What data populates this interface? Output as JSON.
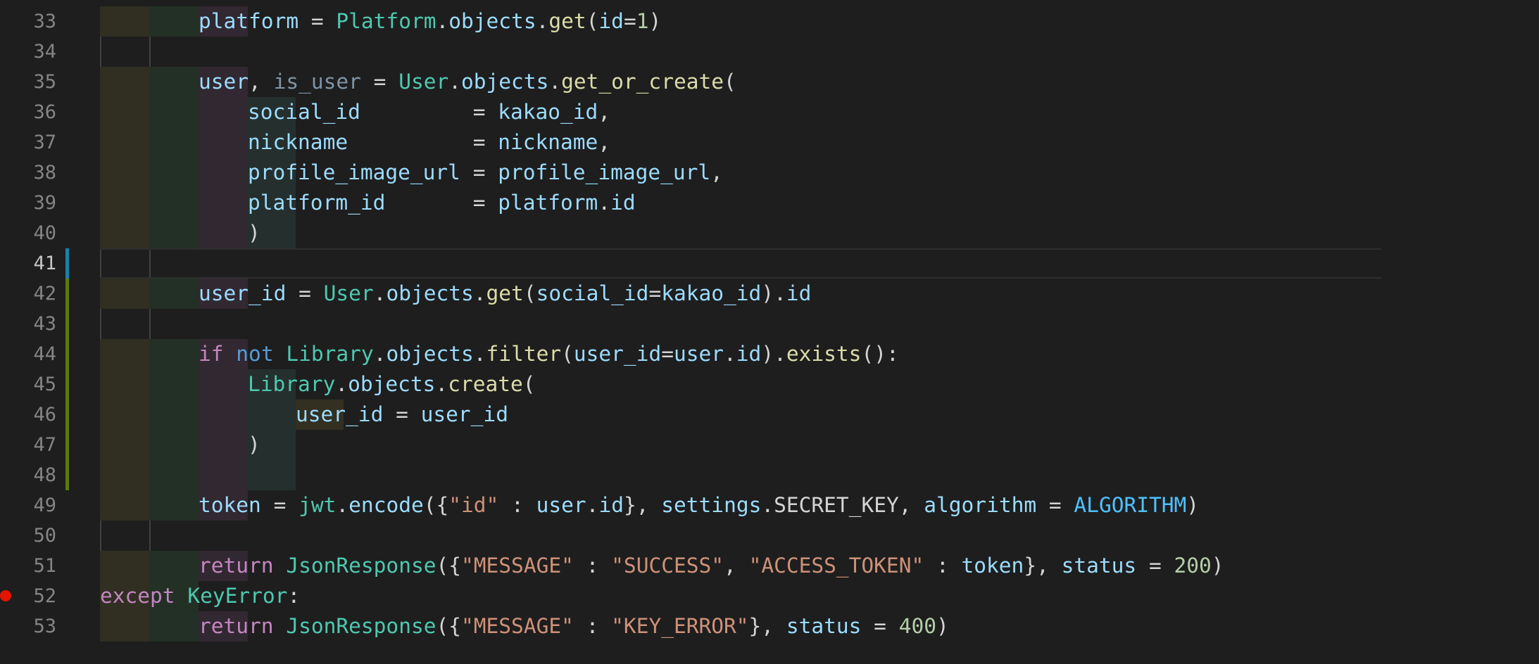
{
  "colors": {
    "background": "#1e1e1e",
    "line_number": "#858585",
    "keyword": "#c586c0",
    "keyword_alt": "#569cd6",
    "class": "#4ec9b0",
    "function": "#dcdcaa",
    "variable": "#9cdcfe",
    "string": "#ce9178",
    "number": "#b5cea8",
    "constant": "#4fc1ff",
    "breakpoint": "#e51400",
    "modified_marker": "#1b81a8",
    "added_marker": "#587c0c"
  },
  "editor": {
    "lines": [
      {
        "num": "33",
        "indent": 2,
        "bands": 3,
        "tokens": [
          [
            "t-var",
            "platform"
          ],
          [
            "t-op",
            " = "
          ],
          [
            "t-cls",
            "Platform"
          ],
          [
            "t-op",
            "."
          ],
          [
            "t-var",
            "objects"
          ],
          [
            "t-op",
            "."
          ],
          [
            "t-fn",
            "get"
          ],
          [
            "t-op",
            "("
          ],
          [
            "t-var",
            "id"
          ],
          [
            "t-op",
            "="
          ],
          [
            "t-num",
            "1"
          ],
          [
            "t-op",
            ")"
          ]
        ]
      },
      {
        "num": "34",
        "indent": 2,
        "bands": 0,
        "tokens": []
      },
      {
        "num": "35",
        "indent": 2,
        "bands": 3,
        "tokens": [
          [
            "t-var",
            "user"
          ],
          [
            "t-op",
            ", "
          ],
          [
            "t-dim",
            "is_user"
          ],
          [
            "t-op",
            " = "
          ],
          [
            "t-cls",
            "User"
          ],
          [
            "t-op",
            "."
          ],
          [
            "t-var",
            "objects"
          ],
          [
            "t-op",
            "."
          ],
          [
            "t-fn",
            "get_or_create"
          ],
          [
            "t-op",
            "("
          ]
        ]
      },
      {
        "num": "36",
        "indent": 3,
        "bands": 4,
        "tokens": [
          [
            "t-var",
            "social_id"
          ],
          [
            "t-op",
            "         = "
          ],
          [
            "t-var",
            "kakao_id"
          ],
          [
            "t-op",
            ","
          ]
        ]
      },
      {
        "num": "37",
        "indent": 3,
        "bands": 4,
        "tokens": [
          [
            "t-var",
            "nickname"
          ],
          [
            "t-op",
            "          = "
          ],
          [
            "t-var",
            "nickname"
          ],
          [
            "t-op",
            ","
          ]
        ]
      },
      {
        "num": "38",
        "indent": 3,
        "bands": 4,
        "tokens": [
          [
            "t-var",
            "profile_image_url"
          ],
          [
            "t-op",
            " = "
          ],
          [
            "t-var",
            "profile_image_url"
          ],
          [
            "t-op",
            ","
          ]
        ]
      },
      {
        "num": "39",
        "indent": 3,
        "bands": 4,
        "tokens": [
          [
            "t-var",
            "platform_id"
          ],
          [
            "t-op",
            "       = "
          ],
          [
            "t-var",
            "platform"
          ],
          [
            "t-op",
            "."
          ],
          [
            "t-var",
            "id"
          ]
        ]
      },
      {
        "num": "40",
        "indent": 3,
        "bands": 4,
        "tokens": [
          [
            "t-op",
            ")"
          ]
        ]
      },
      {
        "num": "41",
        "indent": 2,
        "bands": 0,
        "active": true,
        "marker": "mod",
        "tokens": []
      },
      {
        "num": "42",
        "indent": 2,
        "bands": 3,
        "marker": "add",
        "tokens": [
          [
            "t-var",
            "user_id"
          ],
          [
            "t-op",
            " = "
          ],
          [
            "t-cls",
            "User"
          ],
          [
            "t-op",
            "."
          ],
          [
            "t-var",
            "objects"
          ],
          [
            "t-op",
            "."
          ],
          [
            "t-fn",
            "get"
          ],
          [
            "t-op",
            "("
          ],
          [
            "t-var",
            "social_id"
          ],
          [
            "t-op",
            "="
          ],
          [
            "t-var",
            "kakao_id"
          ],
          [
            "t-op",
            ")."
          ],
          [
            "t-var",
            "id"
          ]
        ]
      },
      {
        "num": "43",
        "indent": 2,
        "bands": 0,
        "marker": "add",
        "tokens": []
      },
      {
        "num": "44",
        "indent": 2,
        "bands": 3,
        "marker": "add",
        "tokens": [
          [
            "t-kw",
            "if"
          ],
          [
            "t-op",
            " "
          ],
          [
            "t-kw2",
            "not"
          ],
          [
            "t-op",
            " "
          ],
          [
            "t-cls",
            "Library"
          ],
          [
            "t-op",
            "."
          ],
          [
            "t-var",
            "objects"
          ],
          [
            "t-op",
            "."
          ],
          [
            "t-fn",
            "filter"
          ],
          [
            "t-op",
            "("
          ],
          [
            "t-var",
            "user_id"
          ],
          [
            "t-op",
            "="
          ],
          [
            "t-var",
            "user"
          ],
          [
            "t-op",
            "."
          ],
          [
            "t-var",
            "id"
          ],
          [
            "t-op",
            ")."
          ],
          [
            "t-fn",
            "exists"
          ],
          [
            "t-op",
            "():"
          ]
        ]
      },
      {
        "num": "45",
        "indent": 3,
        "bands": 4,
        "marker": "add",
        "tokens": [
          [
            "t-cls",
            "Library"
          ],
          [
            "t-op",
            "."
          ],
          [
            "t-var",
            "objects"
          ],
          [
            "t-op",
            "."
          ],
          [
            "t-fn",
            "create"
          ],
          [
            "t-op",
            "("
          ]
        ]
      },
      {
        "num": "46",
        "indent": 4,
        "bands": 5,
        "marker": "add",
        "tokens": [
          [
            "t-var",
            "user_id"
          ],
          [
            "t-op",
            " = "
          ],
          [
            "t-var",
            "user_id"
          ]
        ]
      },
      {
        "num": "47",
        "indent": 3,
        "bands": 4,
        "marker": "add",
        "tokens": [
          [
            "t-op",
            ")"
          ]
        ]
      },
      {
        "num": "48",
        "indent": 3,
        "bands": 4,
        "marker": "add",
        "tokens": []
      },
      {
        "num": "49",
        "indent": 2,
        "bands": 3,
        "tokens": [
          [
            "t-var",
            "token"
          ],
          [
            "t-op",
            " = "
          ],
          [
            "t-cls",
            "jwt"
          ],
          [
            "t-op",
            "."
          ],
          [
            "t-var",
            "encode"
          ],
          [
            "t-op",
            "({"
          ],
          [
            "t-str",
            "\"id\""
          ],
          [
            "t-op",
            " : "
          ],
          [
            "t-var",
            "user"
          ],
          [
            "t-op",
            "."
          ],
          [
            "t-var",
            "id"
          ],
          [
            "t-op",
            "}, "
          ],
          [
            "t-var",
            "settings"
          ],
          [
            "t-op",
            "."
          ],
          [
            "t-op",
            "SECRET_KEY"
          ],
          [
            "t-op",
            ", "
          ],
          [
            "t-var",
            "algorithm"
          ],
          [
            "t-op",
            " = "
          ],
          [
            "t-const",
            "ALGORITHM"
          ],
          [
            "t-op",
            ")"
          ]
        ]
      },
      {
        "num": "50",
        "indent": 2,
        "bands": 0,
        "tokens": []
      },
      {
        "num": "51",
        "indent": 2,
        "bands": 3,
        "tokens": [
          [
            "t-kw",
            "return"
          ],
          [
            "t-op",
            " "
          ],
          [
            "t-cls",
            "JsonResponse"
          ],
          [
            "t-op",
            "({"
          ],
          [
            "t-str",
            "\"MESSAGE\""
          ],
          [
            "t-op",
            " : "
          ],
          [
            "t-str",
            "\"SUCCESS\""
          ],
          [
            "t-op",
            ", "
          ],
          [
            "t-str",
            "\"ACCESS_TOKEN\""
          ],
          [
            "t-op",
            " : "
          ],
          [
            "t-var",
            "token"
          ],
          [
            "t-op",
            "}, "
          ],
          [
            "t-var",
            "status"
          ],
          [
            "t-op",
            " = "
          ],
          [
            "t-num",
            "200"
          ],
          [
            "t-op",
            ")"
          ]
        ]
      },
      {
        "num": "52",
        "indent": 1,
        "bands": 2,
        "breakpoint": true,
        "tokens": [
          [
            "t-kw",
            "except"
          ],
          [
            "t-op",
            " "
          ],
          [
            "t-cls",
            "KeyError"
          ],
          [
            "t-op",
            ":"
          ]
        ]
      },
      {
        "num": "53",
        "indent": 2,
        "bands": 3,
        "tokens": [
          [
            "t-kw",
            "return"
          ],
          [
            "t-op",
            " "
          ],
          [
            "t-cls",
            "JsonResponse"
          ],
          [
            "t-op",
            "({"
          ],
          [
            "t-str",
            "\"MESSAGE\""
          ],
          [
            "t-op",
            " : "
          ],
          [
            "t-str",
            "\"KEY_ERROR\""
          ],
          [
            "t-op",
            "}, "
          ],
          [
            "t-var",
            "status"
          ],
          [
            "t-op",
            " = "
          ],
          [
            "t-num",
            "400"
          ],
          [
            "t-op",
            ")"
          ]
        ]
      }
    ]
  }
}
